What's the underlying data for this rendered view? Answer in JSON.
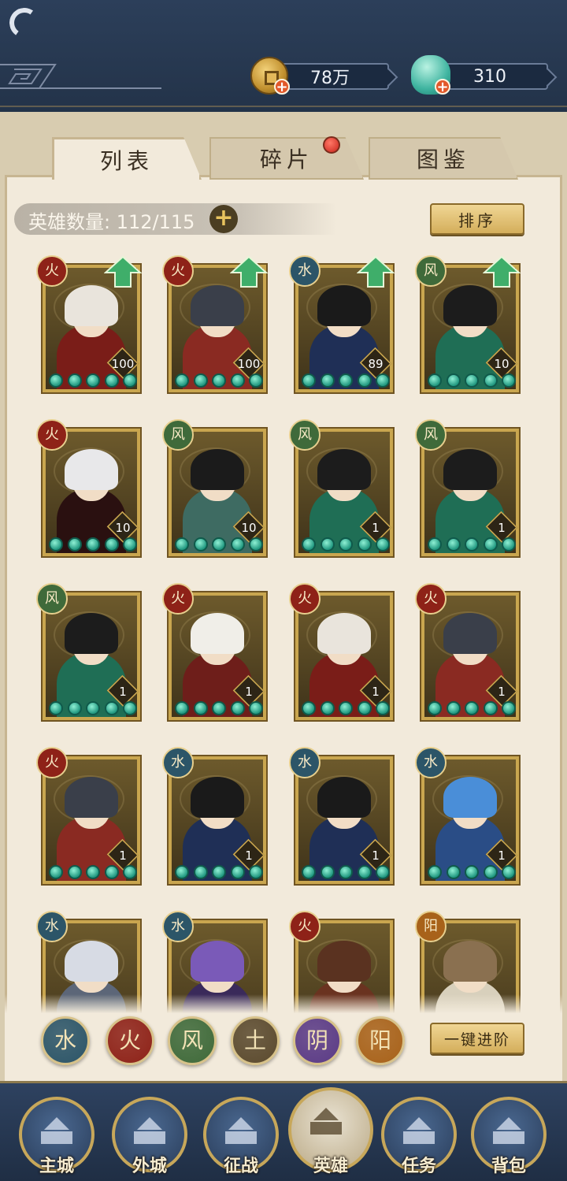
{
  "resources": {
    "coins": "78万",
    "jade": "310"
  },
  "tabs": [
    {
      "label": "列表",
      "active": true
    },
    {
      "label": "碎片",
      "active": false,
      "notification": true
    },
    {
      "label": "图鉴",
      "active": false
    }
  ],
  "hero_count": {
    "label": "英雄数量: 112/115",
    "owned": 112,
    "total": 115
  },
  "buttons": {
    "sort": "排序",
    "advance_all": "一键进阶"
  },
  "heroes": [
    {
      "element": "火",
      "level": "100",
      "upgrade": true
    },
    {
      "element": "火",
      "level": "100",
      "upgrade": true
    },
    {
      "element": "水",
      "level": "89",
      "upgrade": true
    },
    {
      "element": "风",
      "level": "10",
      "upgrade": true
    },
    {
      "element": "火",
      "level": "10",
      "upgrade": false
    },
    {
      "element": "风",
      "level": "10",
      "upgrade": false
    },
    {
      "element": "风",
      "level": "1",
      "upgrade": false
    },
    {
      "element": "风",
      "level": "1",
      "upgrade": false
    },
    {
      "element": "风",
      "level": "1",
      "upgrade": false
    },
    {
      "element": "火",
      "level": "1",
      "upgrade": false
    },
    {
      "element": "火",
      "level": "1",
      "upgrade": false
    },
    {
      "element": "火",
      "level": "1",
      "upgrade": false
    },
    {
      "element": "火",
      "level": "1",
      "upgrade": false
    },
    {
      "element": "水",
      "level": "1",
      "upgrade": false
    },
    {
      "element": "水",
      "level": "1",
      "upgrade": false
    },
    {
      "element": "水",
      "level": "1",
      "upgrade": false
    },
    {
      "element": "水",
      "level": "",
      "upgrade": false
    },
    {
      "element": "水",
      "level": "",
      "upgrade": false
    },
    {
      "element": "火",
      "level": "",
      "upgrade": false
    },
    {
      "element": "阳",
      "level": "",
      "upgrade": false
    }
  ],
  "element_filters": [
    {
      "glyph": "水",
      "color": "#2c5568"
    },
    {
      "glyph": "火",
      "color": "#8e2218"
    },
    {
      "glyph": "风",
      "color": "#3f6a3a"
    },
    {
      "glyph": "土",
      "color": "#5b4a2e"
    },
    {
      "glyph": "阴",
      "color": "#5b3b86"
    },
    {
      "glyph": "阳",
      "color": "#a8621a"
    }
  ],
  "nav": [
    {
      "label": "主城"
    },
    {
      "label": "外城"
    },
    {
      "label": "征战"
    },
    {
      "label": "英雄",
      "active": true
    },
    {
      "label": "任务"
    },
    {
      "label": "背包"
    }
  ],
  "colors": {
    "header_bg": "#2c3f5a",
    "parchment": "#f2eadb",
    "gold": "#d4ae5b",
    "star_jade": "#219880",
    "upgrade_arrow": "#3fae6a"
  }
}
